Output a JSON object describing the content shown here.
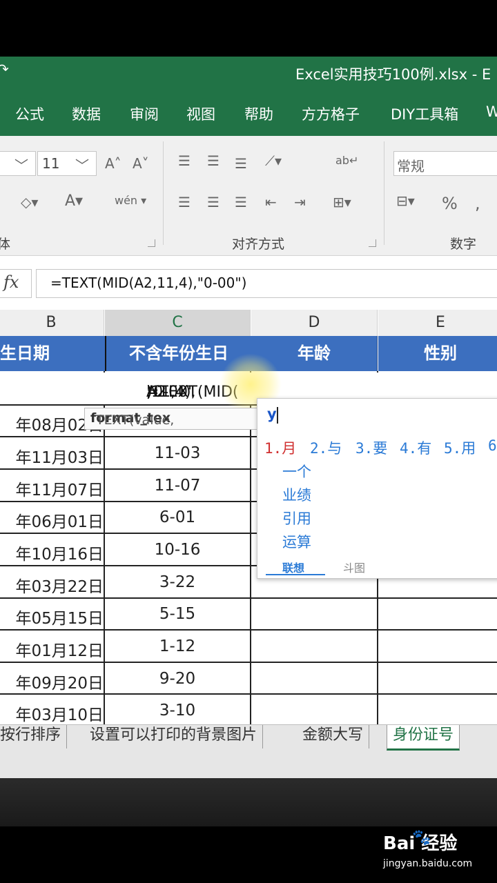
{
  "window": {
    "title": "Excel实用技巧100例.xlsx  -  E"
  },
  "ribbon_tabs": [
    "公式",
    "数据",
    "审阅",
    "视图",
    "帮助",
    "方方格子",
    "DIY工具箱",
    "W"
  ],
  "ribbon": {
    "font_size": "11",
    "number_format": "常规",
    "group_font_label": "体",
    "group_align_label": "对齐方式",
    "group_number_label": "数字",
    "fx_label": "fx"
  },
  "formula_bar": {
    "formula": "=TEXT(MID(A2,11,4),\"0-00\")"
  },
  "columns": [
    "B",
    "C",
    "D",
    "E"
  ],
  "header_row": {
    "B": "生日期",
    "C": "不含年份生日",
    "D": "年龄",
    "E": "性别"
  },
  "editing_cell": {
    "part1": "=TEXT(MID(",
    "ref": "A2",
    "part2": ",11,4),",
    "str": "\"0-00\"",
    "part3": ")"
  },
  "tooltip": {
    "fn": "TEXT(value, ",
    "arg": "format_tex"
  },
  "rows": [
    {
      "b": "年08月02日",
      "c": ""
    },
    {
      "b": "年11月03日",
      "c": "11-03"
    },
    {
      "b": "年11月07日",
      "c": "11-07"
    },
    {
      "b": "年06月01日",
      "c": "6-01"
    },
    {
      "b": "年10月16日",
      "c": "10-16"
    },
    {
      "b": "年03月22日",
      "c": "3-22"
    },
    {
      "b": "年05月15日",
      "c": "5-15"
    },
    {
      "b": "年01月12日",
      "c": "1-12"
    },
    {
      "b": "年09月20日",
      "c": "9-20"
    },
    {
      "b": "年03月10日",
      "c": "3-10"
    }
  ],
  "ime": {
    "input": "y",
    "top_candidates": [
      "1.月",
      "2.与",
      "3.要",
      "4.有",
      "5.用",
      "6"
    ],
    "more_candidates": [
      "一个",
      "业绩",
      "引用",
      "运算"
    ],
    "footer_tabs": [
      "联想",
      "斗图"
    ]
  },
  "sheet_tabs": [
    "按行排序",
    "设置可以打印的背景图片",
    "金额大写",
    "身份证号"
  ],
  "watermark": {
    "logo": "Bai  经验",
    "url": "jingyan.baidu.com"
  }
}
